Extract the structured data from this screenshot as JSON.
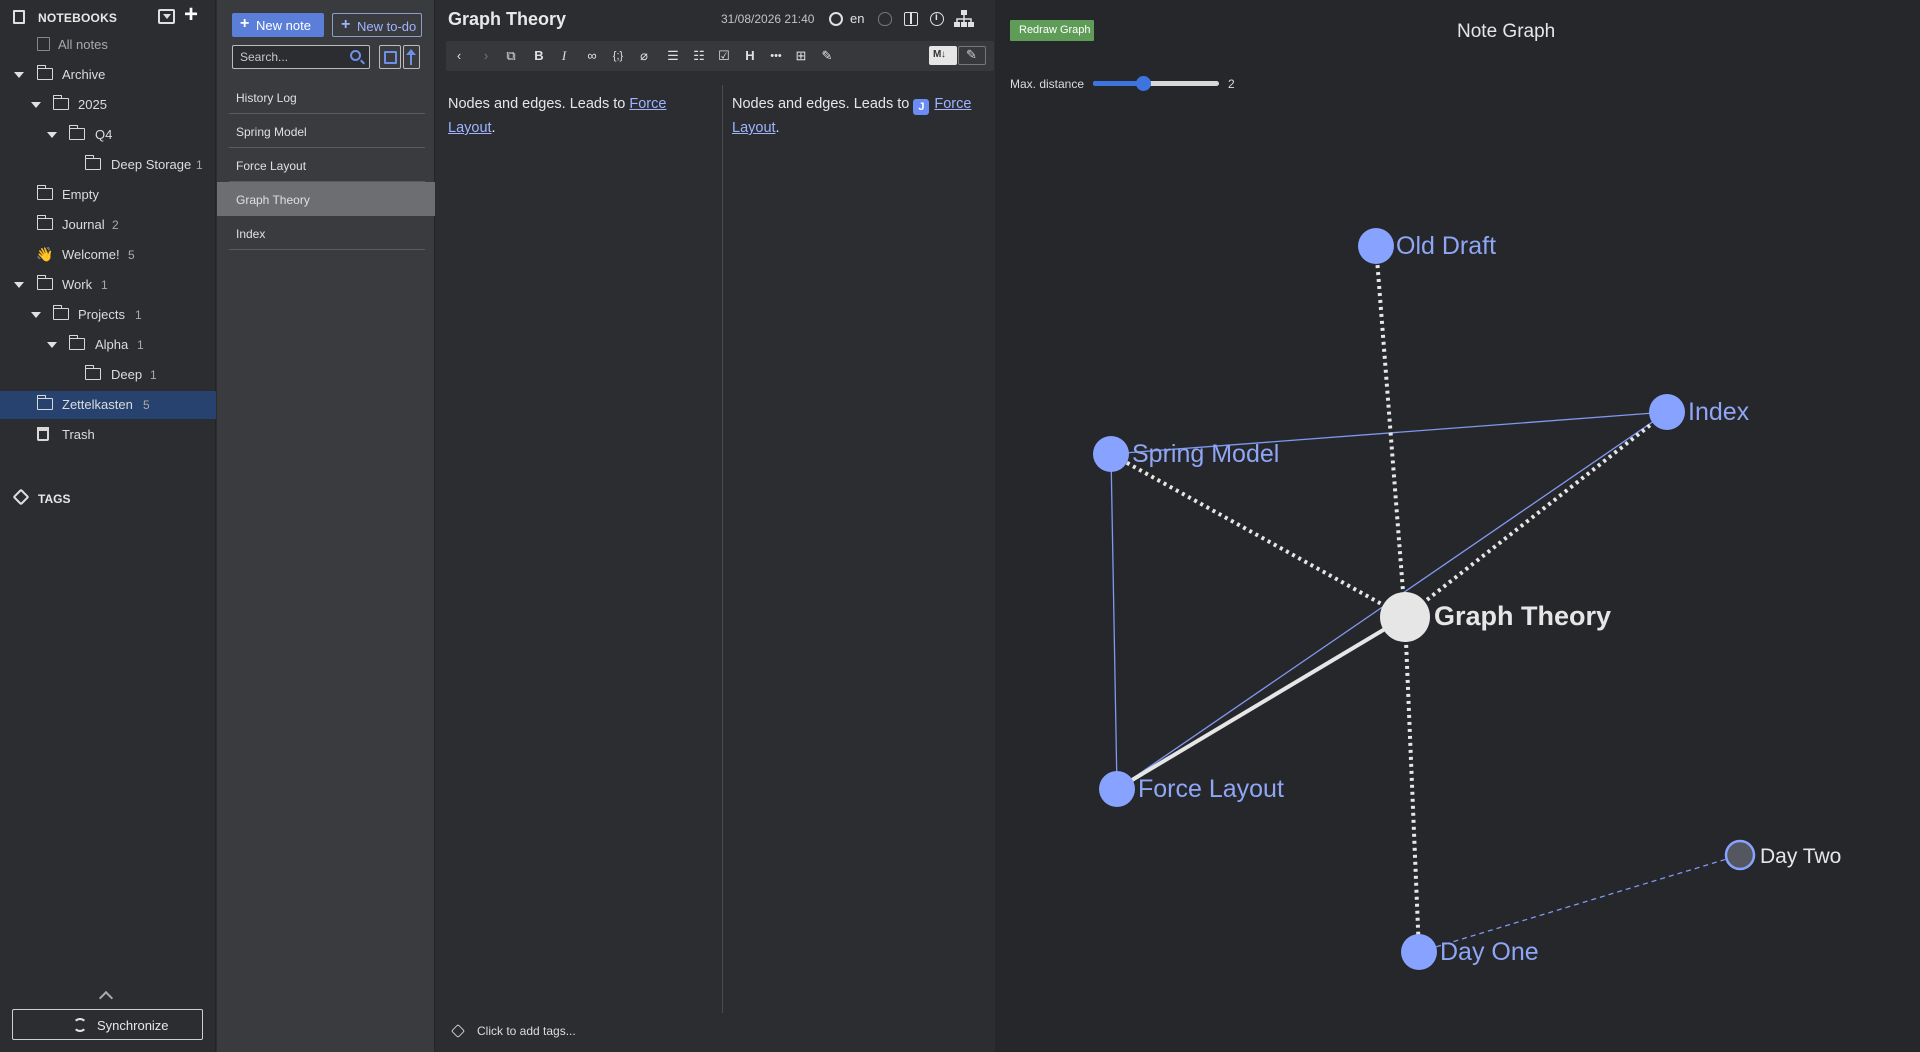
{
  "sidebar": {
    "title": "NOTEBOOKS",
    "all_notes": "All notes",
    "items": [
      {
        "label": "Archive",
        "count": ""
      },
      {
        "label": "2025",
        "count": ""
      },
      {
        "label": "Q4",
        "count": ""
      },
      {
        "label": "Deep Storage",
        "count": "1"
      },
      {
        "label": "Empty",
        "count": ""
      },
      {
        "label": "Journal",
        "count": "2"
      },
      {
        "label": "Welcome!",
        "count": "5",
        "emoji": "👋"
      },
      {
        "label": "Work",
        "count": "1"
      },
      {
        "label": "Projects",
        "count": "1"
      },
      {
        "label": "Alpha",
        "count": "1"
      },
      {
        "label": "Deep",
        "count": "1"
      },
      {
        "label": "Zettelkasten",
        "count": "5"
      },
      {
        "label": "Trash",
        "count": ""
      }
    ],
    "tags_title": "TAGS",
    "sync_label": "Synchronize"
  },
  "notelist": {
    "new_note": "New note",
    "new_todo": "New to-do",
    "search_placeholder": "Search...",
    "notes": [
      "History Log",
      "Spring Model",
      "Force Layout",
      "Graph Theory",
      "Index"
    ],
    "selected_note": "Graph Theory"
  },
  "editor": {
    "title": "Graph Theory",
    "date": "31/08/2026 21:40",
    "language": "en",
    "body_text": "Nodes and edges. Leads to ",
    "link_text": "Force Layout",
    "body_end": ".",
    "tags_placeholder": "Click to add tags..."
  },
  "graph": {
    "redraw_label": "Redraw Graph",
    "title": "Note Graph",
    "max_distance_label": "Max. distance",
    "max_distance": 2,
    "max_distance_fraction": 0.4,
    "nodes": [
      "Old Draft",
      "Index",
      "Spring Model",
      "Graph Theory",
      "Force Layout",
      "Day Two",
      "Day One"
    ]
  },
  "colors": {
    "accent": "#5b7fd9",
    "node": "#87a3ff",
    "node_label": "#8ea6f5",
    "center_node": "#e6e6e6",
    "selected_notebook": "#27426e",
    "redraw_button": "#5f9c58"
  }
}
